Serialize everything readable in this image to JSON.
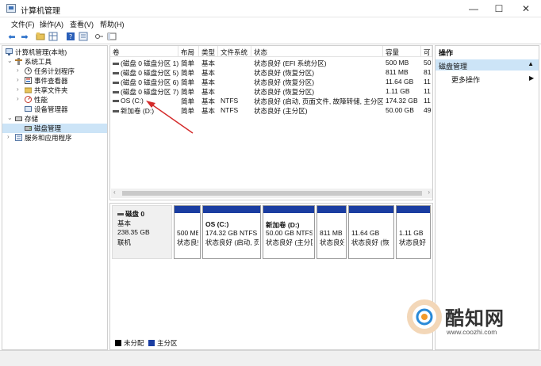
{
  "window": {
    "title": "计算机管理",
    "minimize": "—",
    "maximize": "☐",
    "close": "✕"
  },
  "menu": [
    "文件(F)",
    "操作(A)",
    "查看(V)",
    "帮助(H)"
  ],
  "toolbar_icons": [
    "back-icon",
    "forward-icon",
    "folder-icon",
    "grid-icon",
    "help-icon",
    "properties-icon",
    "key-icon",
    "panel-icon"
  ],
  "tree": {
    "root": "计算机管理(本地)",
    "system_tools": "系统工具",
    "task_scheduler": "任务计划程序",
    "event_viewer": "事件查看器",
    "shared_folders": "共享文件夹",
    "performance": "性能",
    "device_manager": "设备管理器",
    "storage": "存储",
    "disk_management": "磁盘管理",
    "services_apps": "服务和应用程序"
  },
  "volume_table": {
    "headers": [
      "卷",
      "布局",
      "类型",
      "文件系统",
      "状态",
      "容量",
      "可"
    ],
    "rows": [
      {
        "vol": "(磁盘 0 磁盘分区 1)",
        "layout": "简单",
        "type": "基本",
        "fs": "",
        "status": "状态良好 (EFI 系统分区)",
        "capacity": "500 MB",
        "free": "50"
      },
      {
        "vol": "(磁盘 0 磁盘分区 5)",
        "layout": "简单",
        "type": "基本",
        "fs": "",
        "status": "状态良好 (恢复分区)",
        "capacity": "811 MB",
        "free": "81"
      },
      {
        "vol": "(磁盘 0 磁盘分区 6)",
        "layout": "简单",
        "type": "基本",
        "fs": "",
        "status": "状态良好 (恢复分区)",
        "capacity": "11.64 GB",
        "free": "11"
      },
      {
        "vol": "(磁盘 0 磁盘分区 7)",
        "layout": "简单",
        "type": "基本",
        "fs": "",
        "status": "状态良好 (恢复分区)",
        "capacity": "1.11 GB",
        "free": "11"
      },
      {
        "vol": "OS (C:)",
        "layout": "简单",
        "type": "基本",
        "fs": "NTFS",
        "status": "状态良好 (启动, 页面文件, 故障转储, 主分区)",
        "capacity": "174.32 GB",
        "free": "11"
      },
      {
        "vol": "新加卷 (D:)",
        "layout": "简单",
        "type": "基本",
        "fs": "NTFS",
        "status": "状态良好 (主分区)",
        "capacity": "50.00 GB",
        "free": "49"
      }
    ]
  },
  "disk": {
    "name": "磁盘 0",
    "type": "基本",
    "size": "238.35 GB",
    "state": "联机",
    "partitions": [
      {
        "name": "",
        "size": "500 MB",
        "status": "状态良好"
      },
      {
        "name": "OS (C:)",
        "size": "174.32 GB NTFS",
        "status": "状态良好 (启动, 页"
      },
      {
        "name": "新加卷 (D:)",
        "size": "50.00 GB NTFS",
        "status": "状态良好 (主分区"
      },
      {
        "name": "",
        "size": "811 MB",
        "status": "状态良好"
      },
      {
        "name": "",
        "size": "11.64 GB",
        "status": "状态良好 (恢"
      },
      {
        "name": "",
        "size": "1.11 GB",
        "status": "状态良好"
      }
    ]
  },
  "legend": {
    "unallocated": "未分配",
    "primary": "主分区",
    "unallocated_color": "#000000",
    "primary_color": "#1a3da1"
  },
  "actions": {
    "title": "操作",
    "selected": "磁盘管理",
    "more": "更多操作"
  },
  "watermark": {
    "brand": "酷知网",
    "url": "www.coozhi.com"
  }
}
